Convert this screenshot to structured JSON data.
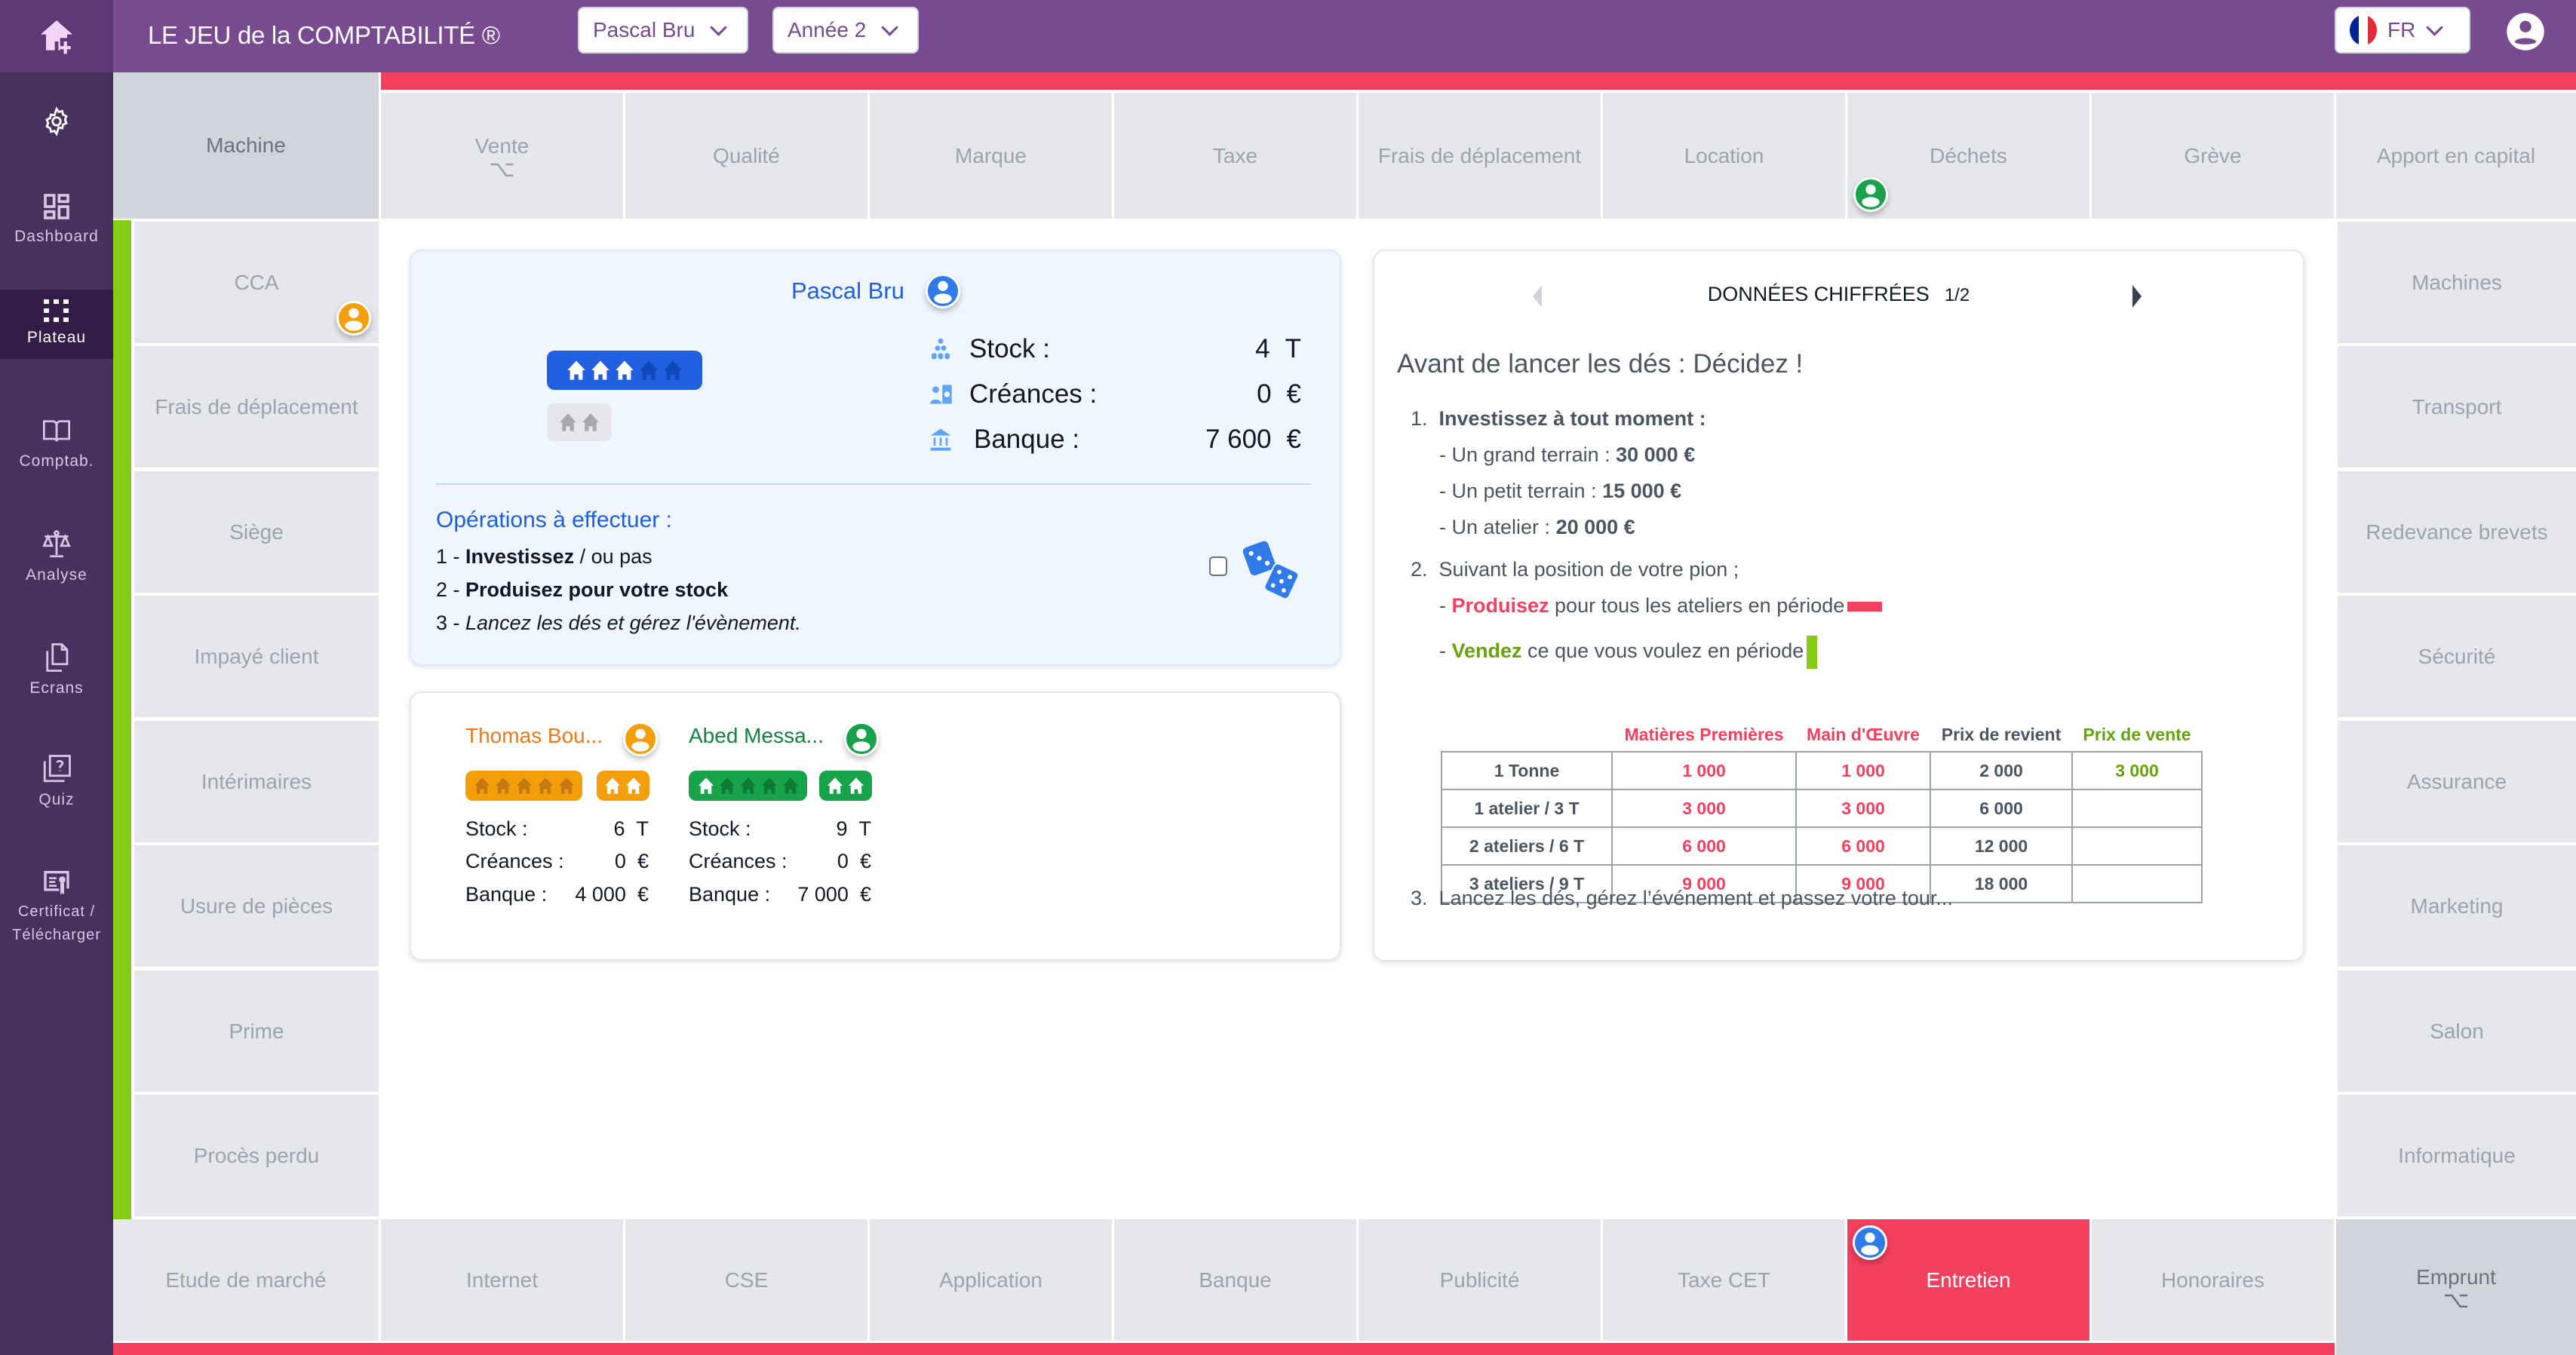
{
  "header": {
    "title": "LE JEU de la COMPTABILITÉ ®",
    "player_select": "Pascal Bru",
    "year_select": "Année 2",
    "language": "FR",
    "icons": {
      "home": "home-add-icon",
      "user": "account-circle-icon",
      "flag": "france-flag-icon"
    }
  },
  "sidebar": {
    "items": [
      {
        "label": "",
        "icon": "gear-icon"
      },
      {
        "label": "Dashboard",
        "icon": "dashboard-icon"
      },
      {
        "label": "Plateau",
        "icon": "grid-dots-icon",
        "active": true
      },
      {
        "label": "Comptab.",
        "icon": "book-icon"
      },
      {
        "label": "Analyse",
        "icon": "scale-icon"
      },
      {
        "label": "Ecrans",
        "icon": "copy-icon"
      },
      {
        "label": "Quiz",
        "icon": "quiz-icon"
      },
      {
        "label": "Certificat / Télécharger",
        "icon": "certificate-icon"
      }
    ]
  },
  "board": {
    "top_row": [
      "Machine",
      "Vente",
      "Qualité",
      "Marque",
      "Taxe",
      "Frais de déplacement",
      "Location",
      "Déchets",
      "Grève",
      "Apport en capital"
    ],
    "left_col": [
      "CCA",
      "Frais de déplacement",
      "Siège",
      "Impayé client",
      "Intérimaires",
      "Usure de pièces",
      "Prime",
      "Procès perdu"
    ],
    "right_col": [
      "Machines",
      "Transport",
      "Redevance brevets",
      "Sécurité",
      "Assurance",
      "Marketing",
      "Salon",
      "Informatique"
    ],
    "bottom_row": [
      "Etude de marché",
      "Internet",
      "CSE",
      "Application",
      "Banque",
      "Publicité",
      "Taxe CET",
      "Entretien",
      "Honoraires",
      "Emprunt"
    ],
    "corner_glyph": "⌥",
    "active_cell": "Entretien",
    "colors": {
      "pink": "#f43f5e",
      "green": "#84cc16",
      "purple": "#784b90",
      "blue": "#2f7bea",
      "orange": "#f59e0b",
      "green_pawn": "#16a34a"
    }
  },
  "current_player": {
    "name": "Pascal Bru",
    "workshops_active": 3,
    "workshops_total": 5,
    "terrains": 2,
    "stock_label": "Stock :",
    "stock_value": "4",
    "stock_unit": "T",
    "creances_label": "Créances :",
    "creances_value": "0",
    "creances_unit": "€",
    "banque_label": "Banque :",
    "banque_value": "7 600",
    "banque_unit": "€",
    "operations_title": "Opérations à effectuer :",
    "operations": [
      {
        "num": "1 - ",
        "bold": "Investissez",
        "rest": " / ou pas"
      },
      {
        "num": "2 - ",
        "bold": "Produisez pour votre stock",
        "rest": ""
      },
      {
        "num": "3 - ",
        "italic": "Lancez les dés et gérez l'évènement."
      }
    ],
    "dice_icon": "dice-icon"
  },
  "other_players": [
    {
      "name": "Thomas Bou...",
      "color": "#f59e0b",
      "text_color": "#ea7a1c",
      "workshops_active": 0,
      "workshops_total": 5,
      "terrains": 2,
      "stock_label": "Stock :",
      "stock_value": "6",
      "stock_unit": "T",
      "creances_label": "Créances :",
      "creances_value": "0",
      "creances_unit": "€",
      "banque_label": "Banque :",
      "banque_value": "4 000",
      "banque_unit": "€"
    },
    {
      "name": "Abed Messa...",
      "color": "#16a34a",
      "text_color": "#15803d",
      "workshops_active": 1,
      "workshops_total": 5,
      "terrains": 2,
      "stock_label": "Stock :",
      "stock_value": "9",
      "stock_unit": "T",
      "creances_label": "Créances :",
      "creances_value": "0",
      "creances_unit": "€",
      "banque_label": "Banque :",
      "banque_value": "7 000",
      "banque_unit": "€"
    }
  ],
  "info_panel": {
    "title": "DONNÉES CHIFFRÉES",
    "page": "1/2",
    "heading": "Avant de lancer les dés : Décidez !",
    "step1": "1.",
    "step1_title": "Investissez à tout moment :",
    "investments": [
      {
        "label": "- Un grand terrain : ",
        "value": "30 000 €"
      },
      {
        "label": "- Un petit terrain : ",
        "value": "15 000 €"
      },
      {
        "label": "- Un atelier : ",
        "value": "20 000 €"
      }
    ],
    "step2": "2.",
    "step2_title": "Suivant la position de votre pion ;",
    "produce_prefix": "- ",
    "produce_bold": "Produisez",
    "produce_rest": " pour tous les ateliers en période",
    "sell_prefix": "- ",
    "sell_bold": "Vendez",
    "sell_rest": " ce que vous voulez en période",
    "table": {
      "headers": [
        "",
        "Matières Premières",
        "Main d'Œuvre",
        "Prix de revient",
        "Prix de vente"
      ],
      "rows": [
        [
          "1 Tonne",
          "1 000",
          "1 000",
          "2 000",
          "3 000"
        ],
        [
          "1 atelier / 3 T",
          "3 000",
          "3 000",
          "6 000",
          ""
        ],
        [
          "2 ateliers / 6 T",
          "6 000",
          "6 000",
          "12 000",
          ""
        ],
        [
          "3 ateliers / 9 T",
          "9 000",
          "9 000",
          "18 000",
          ""
        ]
      ]
    },
    "step3": "3.",
    "step3_text": "Lancez les dés, gérez l’événement et passez votre tour..."
  }
}
